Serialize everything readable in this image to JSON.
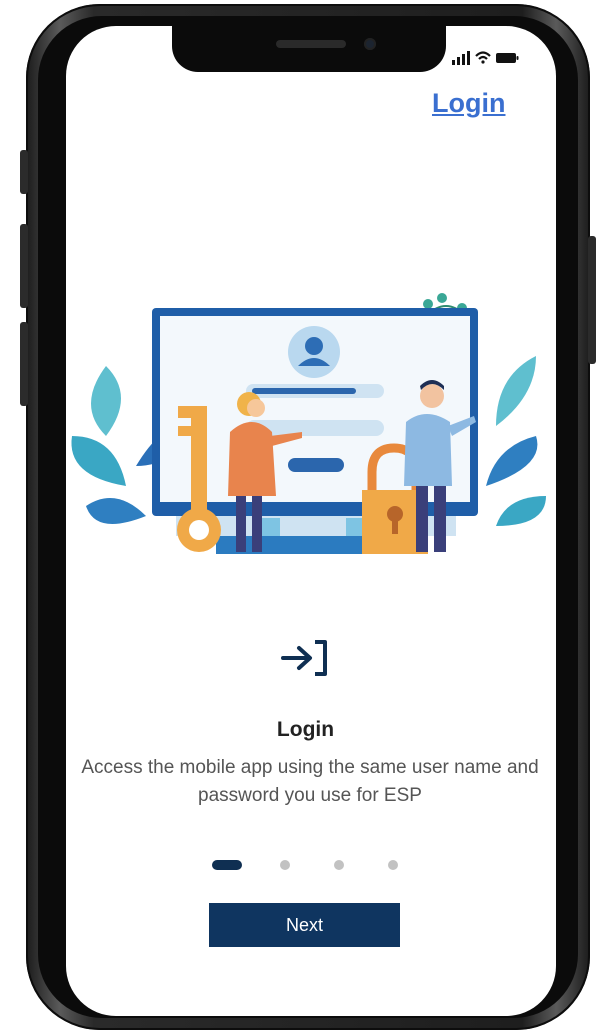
{
  "header": {
    "login_link": "Login"
  },
  "onboarding": {
    "title": "Login",
    "description": "Access the mobile app using the same user name and password you use for ESP",
    "pages": {
      "total": 4,
      "current": 1
    },
    "next_label": "Next"
  },
  "icons": {
    "signin": "sign-in-icon",
    "signal": "signal-icon",
    "wifi": "wifi-icon",
    "battery": "battery-icon"
  },
  "colors": {
    "primary": "#0f3560",
    "link": "#3a6fd0",
    "dot_inactive": "#c2c2c2"
  }
}
